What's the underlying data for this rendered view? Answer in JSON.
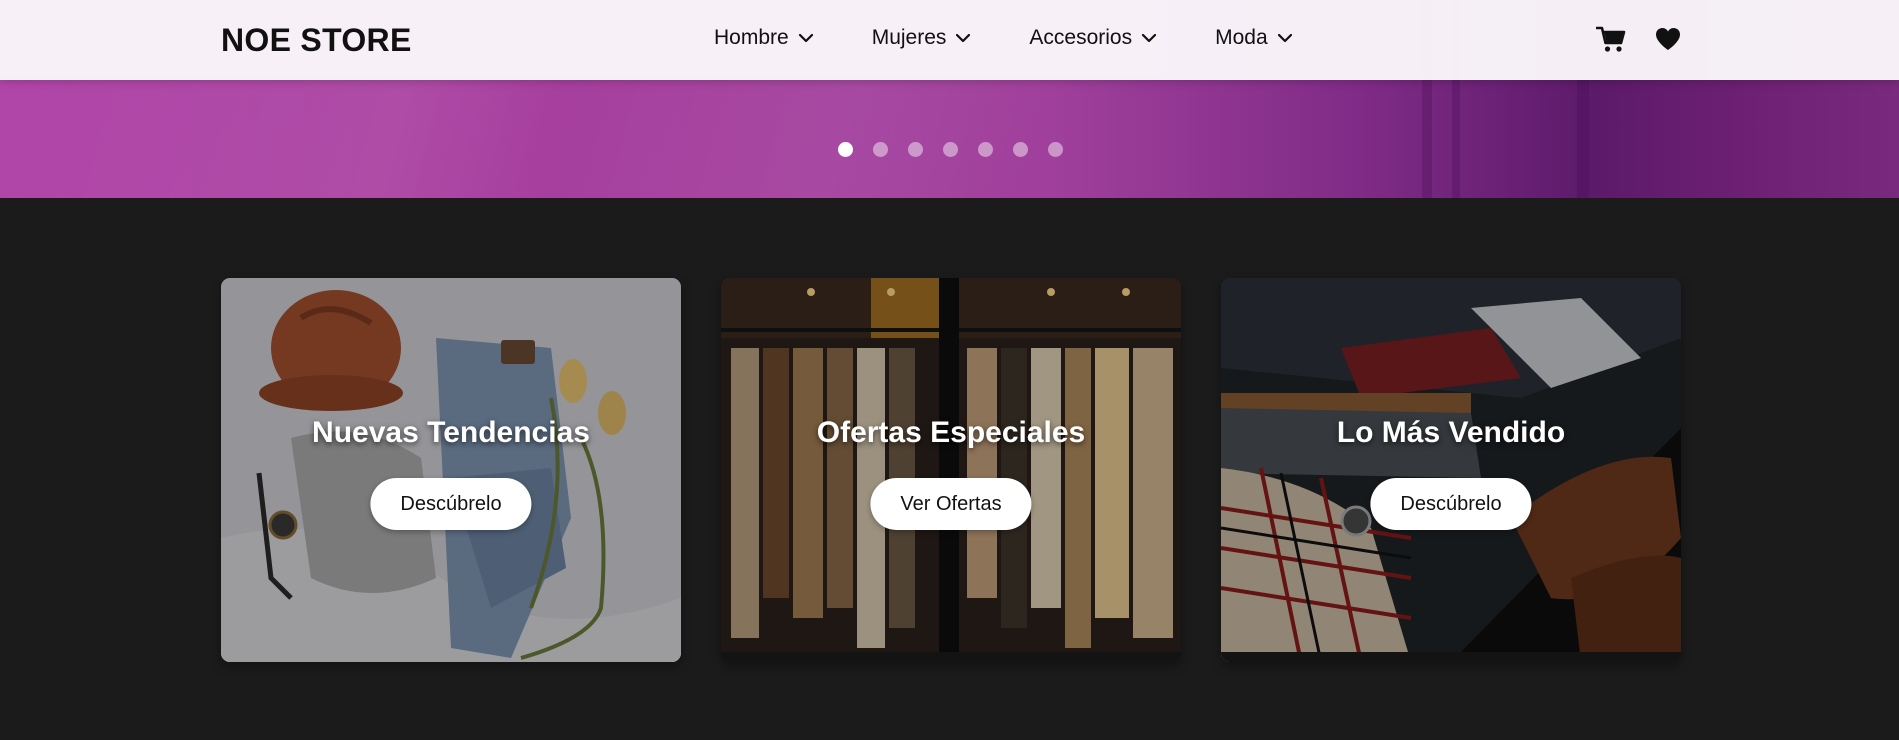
{
  "header": {
    "brand": "NOE STORE",
    "nav": [
      {
        "label": "Hombre"
      },
      {
        "label": "Mujeres"
      },
      {
        "label": "Accesorios"
      },
      {
        "label": "Moda"
      }
    ],
    "icons": {
      "cart": "shopping-cart-icon",
      "favorites": "heart-icon"
    }
  },
  "carousel": {
    "slide_count": 7,
    "active_index": 0
  },
  "cards": [
    {
      "title": "Nuevas Tendencias",
      "button": "Descúbrelo",
      "image": "flat-lay clothes with knit beanie, jeans and tulips"
    },
    {
      "title": "Ofertas Especiales",
      "button": "Ver Ofertas",
      "image": "clothing rack in boutique"
    },
    {
      "title": "Lo Más Vendido",
      "button": "Descúbrelo",
      "image": "men's outfit with plaid scarf and brown brogues"
    }
  ],
  "colors": {
    "header_bg": "#faf6fa",
    "hero_purple": "#a63f9e",
    "page_bg": "#1b1b1b",
    "button_bg": "#ffffff"
  }
}
